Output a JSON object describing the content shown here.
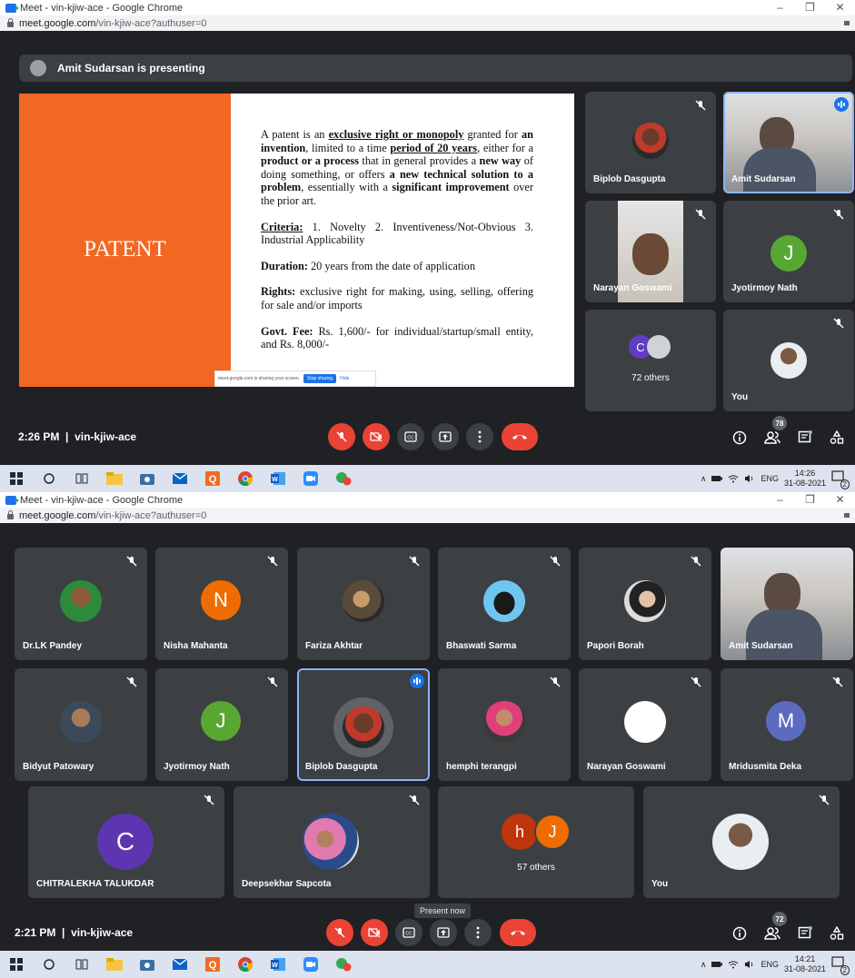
{
  "shot1": {
    "window_title": "Meet - vin-kjiw-ace - Google Chrome",
    "address_domain": "meet.google.com",
    "address_path": "/vin-kjiw-ace?authuser=0",
    "presenting_text": "Amit Sudarsan is presenting",
    "slide": {
      "left_title": "PATENT",
      "p1_a": "A patent is an ",
      "p1_b": "exclusive right or monopoly",
      "p1_c": " granted for ",
      "p1_d": "an invention",
      "p1_e": ", limited to a time ",
      "p1_f": "period of 20 years",
      "p1_g": ", either for a ",
      "p1_h": "product or a process",
      "p1_i": " that in general provides a ",
      "p1_j": "new way",
      "p1_k": " of doing something, or offers ",
      "p1_l": "a new technical solution to a problem",
      "p1_m": ", essentially with a ",
      "p1_n": "significant improvement",
      "p1_o": " over the prior art.",
      "criteria_label": "Criteria:",
      "criteria_text": " 1. Novelty 2. Inventiveness/Not-Obvious 3. Industrial Applicability",
      "duration_label": "Duration:",
      "duration_text": " 20 years from the date of application",
      "rights_label": "Rights:",
      "rights_text": " exclusive right for making, using, selling, offering for sale and/or imports",
      "fee_label": "Govt. Fee:",
      "fee_text": " Rs. 1,600/- for individual/startup/small entity, and Rs. 8,000/-",
      "share_text": "meet.google.com is sharing your screen.",
      "share_stop": "Stop sharing",
      "share_hide": "Hide"
    },
    "tiles": [
      {
        "name": "Biplob Dasgupta"
      },
      {
        "name": "Amit Sudarsan"
      },
      {
        "name": "Narayan Goswami"
      },
      {
        "name": "Jyotirmoy Nath",
        "letter": "J"
      },
      {
        "name": "72 others",
        "letter": "C"
      },
      {
        "name": "You"
      }
    ],
    "time": "2:26 PM",
    "meeting_code": "vin-kjiw-ace",
    "people_count": "78",
    "clock_time": "14:26",
    "clock_date": "31-08-2021",
    "lang": "ENG",
    "notif_count": "2"
  },
  "shot2": {
    "window_title": "Meet - vin-kjiw-ace - Google Chrome",
    "address_domain": "meet.google.com",
    "address_path": "/vin-kjiw-ace?authuser=0",
    "tiles": [
      {
        "name": "Dr.LK Pandey"
      },
      {
        "name": "Nisha Mahanta",
        "letter": "N"
      },
      {
        "name": "Fariza Akhtar"
      },
      {
        "name": "Bhaswati Sarma"
      },
      {
        "name": "Papori Borah"
      },
      {
        "name": "Amit Sudarsan"
      },
      {
        "name": "Bidyut Patowary"
      },
      {
        "name": "Jyotirmoy Nath",
        "letter": "J"
      },
      {
        "name": "Biplob Dasgupta"
      },
      {
        "name": "hemphi terangpi"
      },
      {
        "name": "Narayan Goswami"
      },
      {
        "name": "Mridusmita Deka",
        "letter": "M"
      },
      {
        "name": "CHITRALEKHA TALUKDAR",
        "letter": "C"
      },
      {
        "name": "Deepsekhar Sapcota"
      },
      {
        "name": "57 others",
        "letter_a": "h",
        "letter_b": "J"
      },
      {
        "name": "You"
      }
    ],
    "tooltip": "Present now",
    "time": "2:21 PM",
    "meeting_code": "vin-kjiw-ace",
    "people_count": "72",
    "clock_time": "14:21",
    "clock_date": "31-08-2021",
    "lang": "ENG",
    "notif_count": "2"
  },
  "colors": {
    "meet_bg": "#202124",
    "tile_bg": "#3c4043",
    "danger": "#ea4335",
    "accent": "#1a73e8",
    "slide_orange": "#f26722",
    "speaker_border": "#8ab4f8"
  },
  "icons": [
    "chrome-meet-icon",
    "lock-icon",
    "mic-off-icon",
    "camera-off-icon",
    "captions-icon",
    "present-icon",
    "more-icon",
    "end-call-icon",
    "info-icon",
    "people-icon",
    "chat-icon",
    "activities-icon",
    "windows-start-icon",
    "search-icon",
    "task-view-icon",
    "file-explorer-icon",
    "camera-app-icon",
    "mail-icon",
    "qlik-icon",
    "chrome-icon",
    "word-icon",
    "zoom-icon",
    "wifi-icon",
    "volume-icon",
    "notification-icon"
  ]
}
